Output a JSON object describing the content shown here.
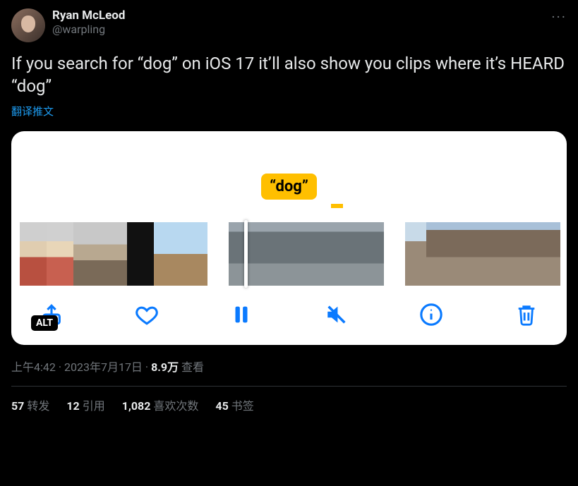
{
  "header": {
    "display_name": "Ryan McLeod",
    "handle": "@warpling"
  },
  "tweet_text": "If you search for “dog” on iOS 17 it’ll also show you clips where it’s HEARD “dog”",
  "translate_label": "翻译推文",
  "media": {
    "search_bubble": "“dog”",
    "alt_badge": "ALT"
  },
  "meta": {
    "time": "上午4:42",
    "date": "2023年7月17日",
    "views_count": "8.9万",
    "views_label": "查看"
  },
  "stats": {
    "retweets_count": "57",
    "retweets_label": "转发",
    "quotes_count": "12",
    "quotes_label": "引用",
    "likes_count": "1,082",
    "likes_label": "喜欢次数",
    "bookmarks_count": "45",
    "bookmarks_label": "书签"
  }
}
